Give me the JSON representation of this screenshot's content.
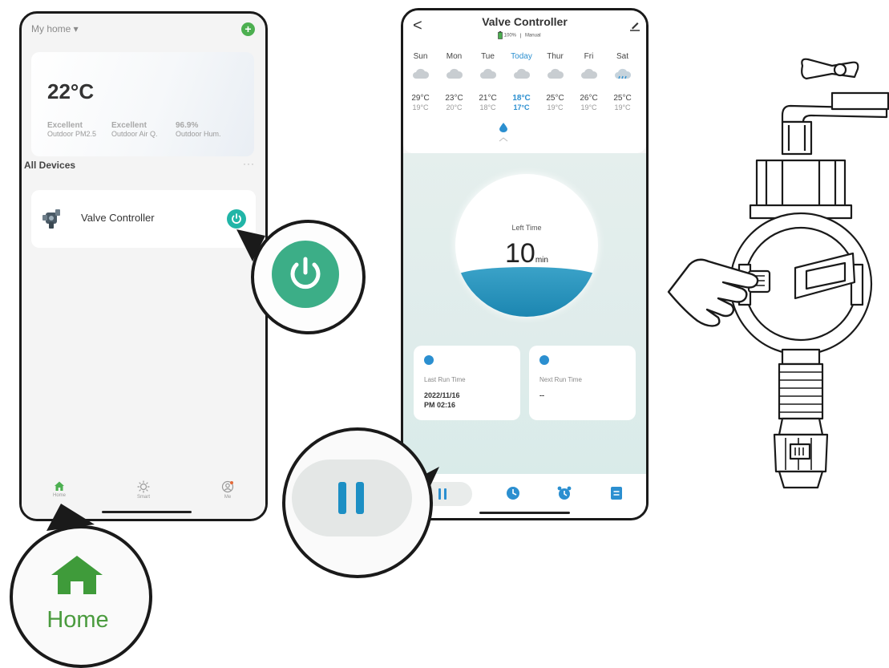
{
  "phone1": {
    "home_selector": "My home ▾",
    "add_button": "+",
    "weather": {
      "temperature": "22°C",
      "stats": [
        {
          "value": "Excellent",
          "label": "Outdoor PM2.5"
        },
        {
          "value": "Excellent",
          "label": "Outdoor Air Q."
        },
        {
          "value": "96.9%",
          "label": "Outdoor Hum."
        }
      ]
    },
    "section_title": "All Devices",
    "more": "···",
    "device": {
      "name": "Valve Controller"
    },
    "tabs": [
      {
        "label": "Home",
        "icon": "home-icon"
      },
      {
        "label": "Smart",
        "icon": "sun-icon"
      },
      {
        "label": "Me",
        "icon": "profile-icon"
      }
    ]
  },
  "zoom": {
    "home_label": "Home"
  },
  "phone2": {
    "back": "<",
    "title": "Valve Controller",
    "battery": "100%",
    "mode": "Manual",
    "days": [
      "Sun",
      "Mon",
      "Tue",
      "Today",
      "Thur",
      "Fri",
      "Sat"
    ],
    "highs": [
      "29°C",
      "23°C",
      "21°C",
      "18°C",
      "25°C",
      "26°C",
      "25°C"
    ],
    "lows": [
      "19°C",
      "20°C",
      "18°C",
      "17°C",
      "19°C",
      "19°C",
      "19°C"
    ],
    "today_index": 3,
    "left_time_label": "Left Time",
    "left_time_value": "10",
    "left_time_unit": "min",
    "left_time_fill": 0.35,
    "last_run": {
      "label": "Last Run Time",
      "line1": "2022/11/16",
      "line2": "PM 02:16"
    },
    "next_run": {
      "label": "Next Run Time",
      "value": "--"
    },
    "tab_icons": [
      "pause-icon",
      "timer-icon",
      "alarm-icon",
      "log-icon"
    ]
  },
  "colors": {
    "green": "#4caf50",
    "teal": "#21b5a7",
    "power_zoom": "#3cae87",
    "blue": "#2b8fd0",
    "water": "#1c86b1"
  }
}
